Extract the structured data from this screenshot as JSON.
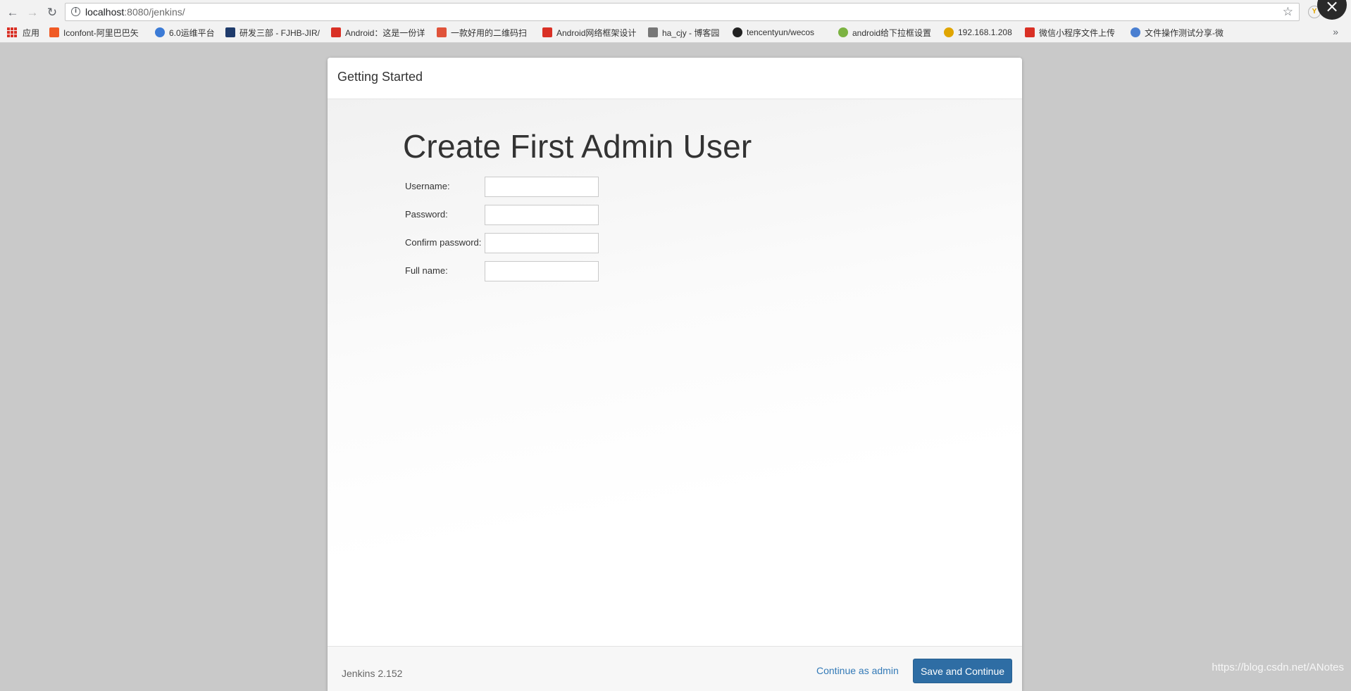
{
  "browser": {
    "url_host": "localhost",
    "url_rest": ":8080/jenkins/",
    "bookmarks": [
      {
        "label": "应用",
        "color": "#d93025"
      },
      {
        "label": "Iconfont-阿里巴巴矢",
        "color": "#f05a24"
      },
      {
        "label": "6.0运维平台",
        "color": "#3c7bd6"
      },
      {
        "label": "研发三部 - FJHB-JIR/",
        "color": "#1f3b6b"
      },
      {
        "label": "Android：这是一份详",
        "color": "#d93025"
      },
      {
        "label": "一款好用的二维码扫",
        "color": "#e0533a"
      },
      {
        "label": "Android网络框架设计",
        "color": "#d93025"
      },
      {
        "label": "ha_cjy - 博客园",
        "color": "#555555"
      },
      {
        "label": "tencentyun/wecos",
        "color": "#222222"
      },
      {
        "label": "android给下拉框设置",
        "color": "#7cb342"
      },
      {
        "label": "192.168.1.208",
        "color": "#e0a500"
      },
      {
        "label": "微信小程序文件上传",
        "color": "#d93025"
      },
      {
        "label": "文件操作测试分享-微",
        "color": "#4a7fd1"
      }
    ]
  },
  "dialog": {
    "header_title": "Getting Started",
    "heading": "Create First Admin User",
    "fields": [
      {
        "label": "Username:",
        "value": ""
      },
      {
        "label": "Password:",
        "value": ""
      },
      {
        "label": "Confirm password:",
        "value": ""
      },
      {
        "label": "Full name:",
        "value": ""
      }
    ],
    "version": "Jenkins 2.152",
    "continue_admin": "Continue as admin",
    "save_continue": "Save and Continue"
  },
  "watermark": "https://blog.csdn.net/ANotes"
}
